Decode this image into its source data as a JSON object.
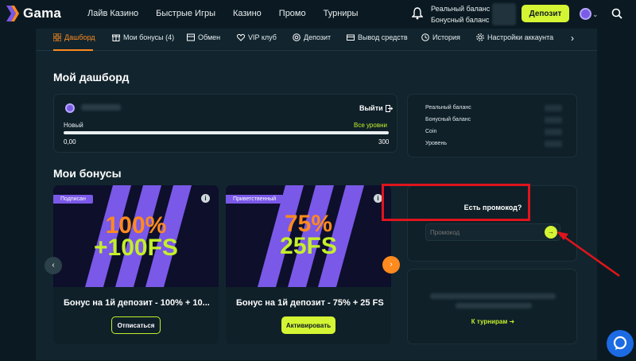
{
  "header": {
    "brand": "Gama",
    "nav": [
      "Лайв Казино",
      "Быстрые Игры",
      "Казино",
      "Промо",
      "Турниры"
    ],
    "real_balance_label": "Реальный баланс",
    "bonus_balance_label": "Бонусный баланс",
    "deposit_label": "Депозит"
  },
  "tabs": [
    {
      "label": "Дашборд",
      "icon": "dashboard-icon",
      "active": true
    },
    {
      "label": "Мои бонусы (4)",
      "icon": "gift-icon"
    },
    {
      "label": "Обмен",
      "icon": "exchange-icon"
    },
    {
      "label": "VIP клуб",
      "icon": "heart-icon"
    },
    {
      "label": "Депозит",
      "icon": "deposit-icon"
    },
    {
      "label": "Вывод средств",
      "icon": "withdraw-icon"
    },
    {
      "label": "История",
      "icon": "history-icon"
    },
    {
      "label": "Настройки аккаунта",
      "icon": "gear-icon"
    }
  ],
  "dashboard": {
    "title": "Мой дашборд",
    "logout_label": "Выйти",
    "level_current": "Новый",
    "level_all_link": "Все уровни",
    "progress_min": "0,00",
    "progress_max": "300",
    "progress_fraction": 1.0
  },
  "balance_panel": {
    "rows": [
      "Реальный баланс",
      "Бонусный баланс",
      "Coin",
      "Уровень"
    ]
  },
  "bonuses": {
    "title": "Мои бонусы",
    "cards": [
      {
        "badge": "Подписан",
        "headline_line1": "100%",
        "headline_line2": "+100FS",
        "title": "Бонус на 1й депозит - 100% + 10...",
        "button_label": "Отписаться"
      },
      {
        "badge": "Приветственный",
        "headline_line1": "75%",
        "headline_line2": "25FS",
        "title": "Бонус на 1й депозит - 75% + 25 FS",
        "button_label": "Активировать"
      }
    ]
  },
  "promo": {
    "title": "Есть промокод?",
    "placeholder": "Промокод"
  },
  "tournaments": {
    "link_label": "К турнирам"
  },
  "colors": {
    "accent_lime": "#d4f533",
    "accent_orange": "#ff8a1f",
    "purple": "#7a58e8",
    "highlight_red": "#e0141c"
  }
}
